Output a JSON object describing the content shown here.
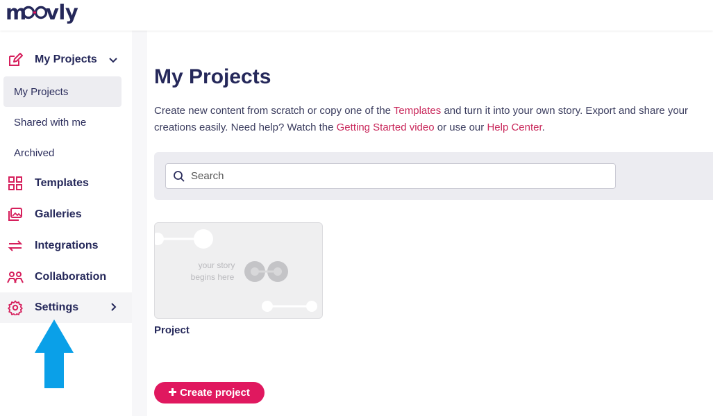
{
  "brand": {
    "logo_text": "moovly"
  },
  "sidebar": {
    "section_my_projects": "My Projects",
    "sub_items": [
      {
        "label": "My Projects"
      },
      {
        "label": "Shared with me"
      },
      {
        "label": "Archived"
      }
    ],
    "templates": "Templates",
    "galleries": "Galleries",
    "integrations": "Integrations",
    "collaboration": "Collaboration",
    "settings": "Settings"
  },
  "main": {
    "title": "My Projects",
    "desc_1": "Create new content from scratch or copy one of the ",
    "link_templates": "Templates",
    "desc_2": " and turn it into your own story. Export and share your creations easily. Need help? Watch the ",
    "link_getting_started": "Getting Started video",
    "desc_3": " or use our ",
    "link_help_center": "Help Center",
    "desc_4": ".",
    "search_placeholder": "Search",
    "project_card": {
      "thumb_line1": "your story",
      "thumb_line2": "begins here",
      "title": "Project"
    },
    "create_button": "Create project"
  },
  "colors": {
    "accent": "#e0185f",
    "navy": "#25285a",
    "arrow": "#0aa0e8"
  }
}
